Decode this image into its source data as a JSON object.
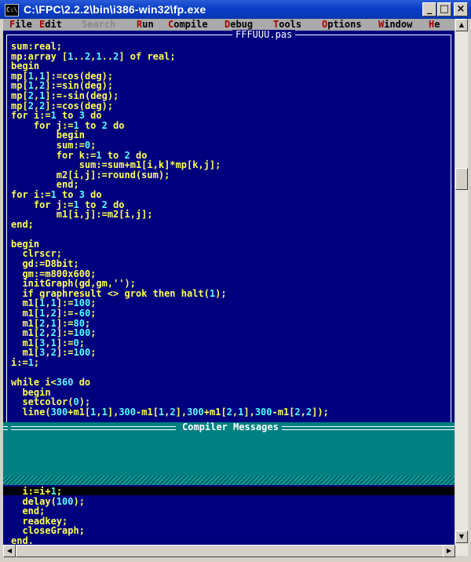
{
  "window": {
    "title": "C:\\FPC\\2.2.2\\bin\\i386-win32\\fp.exe",
    "icon_label": "C:\\",
    "buttons": {
      "minimize": "_",
      "maximize": "□",
      "close": "×"
    }
  },
  "menu": [
    {
      "hot": "F",
      "rest": "ile",
      "disabled": false
    },
    {
      "hot": "E",
      "rest": "dit",
      "disabled": false
    },
    {
      "hot": "",
      "rest": "Search",
      "disabled": true
    },
    {
      "hot": "R",
      "rest": "un",
      "disabled": false
    },
    {
      "hot": "C",
      "rest": "ompile",
      "disabled": false
    },
    {
      "hot": "D",
      "rest": "ebug",
      "disabled": false
    },
    {
      "hot": "T",
      "rest": "ools",
      "disabled": false
    },
    {
      "hot": "O",
      "rest": "ptions",
      "disabled": false
    },
    {
      "hot": "W",
      "rest": "indow",
      "disabled": false
    },
    {
      "hot": "H",
      "rest": "e",
      "disabled": false
    }
  ],
  "editor": {
    "file_name": "FFFUUU.pas",
    "top_lines": [
      "sum:real;",
      "mp:array [{1}..{2},{1}..{2}] of real;",
      "begin",
      "mp[{1},{1}]:=cos(deg);",
      "mp[{1},{2}]:=sin(deg);",
      "mp[{2},{1}]:=-sin(deg);",
      "mp[{2},{2}]:=cos(deg);",
      "for i:={1} to {3} do",
      "    for j:={1} to {2} do",
      "        begin",
      "        sum:={0};",
      "        for k:={1} to {2} do",
      "            sum:=sum+m1[i,k]*mp[k,j];",
      "        m2[i,j]:=round(sum);",
      "        end;",
      "for i:={1} to {3} do",
      "    for j:={1} to {2} do",
      "        m1[i,j]:=m2[i,j];",
      "end;",
      "",
      "begin",
      "  clrscr;",
      "  gd:=D8bit;",
      "  gm:=m800x600;",
      "  initGraph(gd,gm,'');",
      "  if graphresult <> grok then halt({1});",
      "  m1[{1},{1}]:={100};",
      "  m1[{1},{2}]:=-{60};",
      "  m1[{2},{1}]:={80};",
      "  m1[{2},{2}]:={100};",
      "  m1[{3},{1}]:={0};",
      "  m1[{3},{2}]:={100};",
      "i:={1};",
      "",
      "while i<{360} do",
      "  begin",
      "  setcolor({0});",
      "  line({300}+m1[{1},{1}],{300}-m1[{1},{2}],{300}+m1[{2},{1}],{300}-m1[{2},{2}]);"
    ],
    "bottom_lines": [
      "  i:=i+{1};",
      "  delay({100});",
      "  end;",
      "  readkey;",
      "  closeGraph;",
      "end."
    ]
  },
  "messages": {
    "title": "Compiler Messages"
  },
  "colors": {
    "console_bg": "#00007f",
    "code_text": "#ffff55",
    "number_text": "#55ffff",
    "menu_bg": "#aaaaaa",
    "messages_bg": "#008080"
  }
}
